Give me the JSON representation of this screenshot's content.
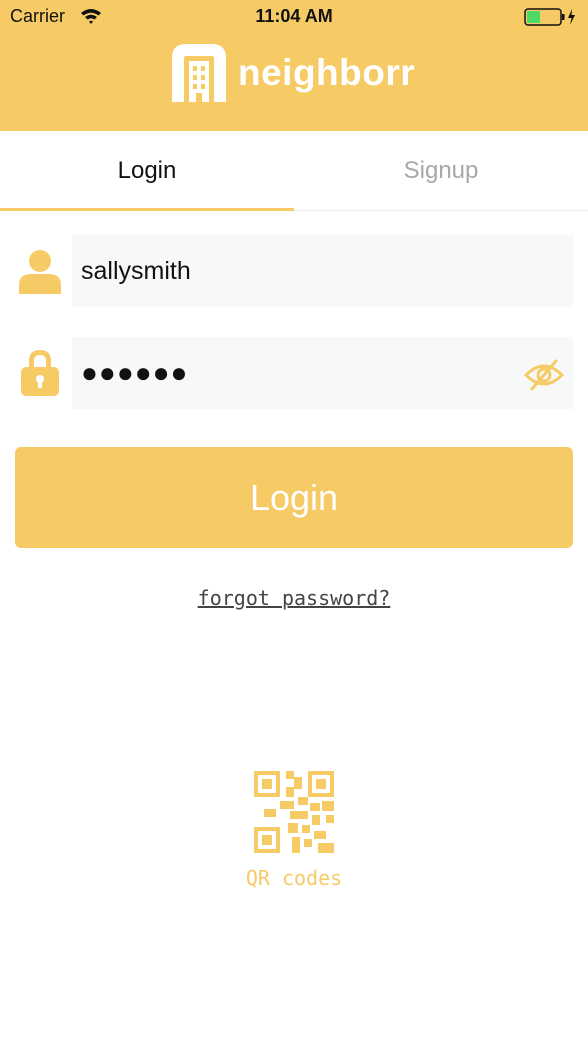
{
  "status_bar": {
    "carrier": "Carrier",
    "time": "11:04 AM"
  },
  "brand": {
    "name": "neighborr"
  },
  "tabs": [
    {
      "label": "Login",
      "active": true
    },
    {
      "label": "Signup",
      "active": false
    }
  ],
  "form": {
    "username_value": "sallysmith",
    "password_masked": "●●●●●●"
  },
  "actions": {
    "login_label": "Login",
    "forgot_label": "forgot password?"
  },
  "qr": {
    "label": "QR codes"
  },
  "colors": {
    "accent": "#f6cb66",
    "inactive_tab": "#a8a8a8",
    "field_bg": "#f8f8f8"
  },
  "icons": [
    "wifi-icon",
    "battery-icon",
    "logo-icon",
    "user-icon",
    "lock-icon",
    "eye-icon",
    "qr-code-icon"
  ]
}
